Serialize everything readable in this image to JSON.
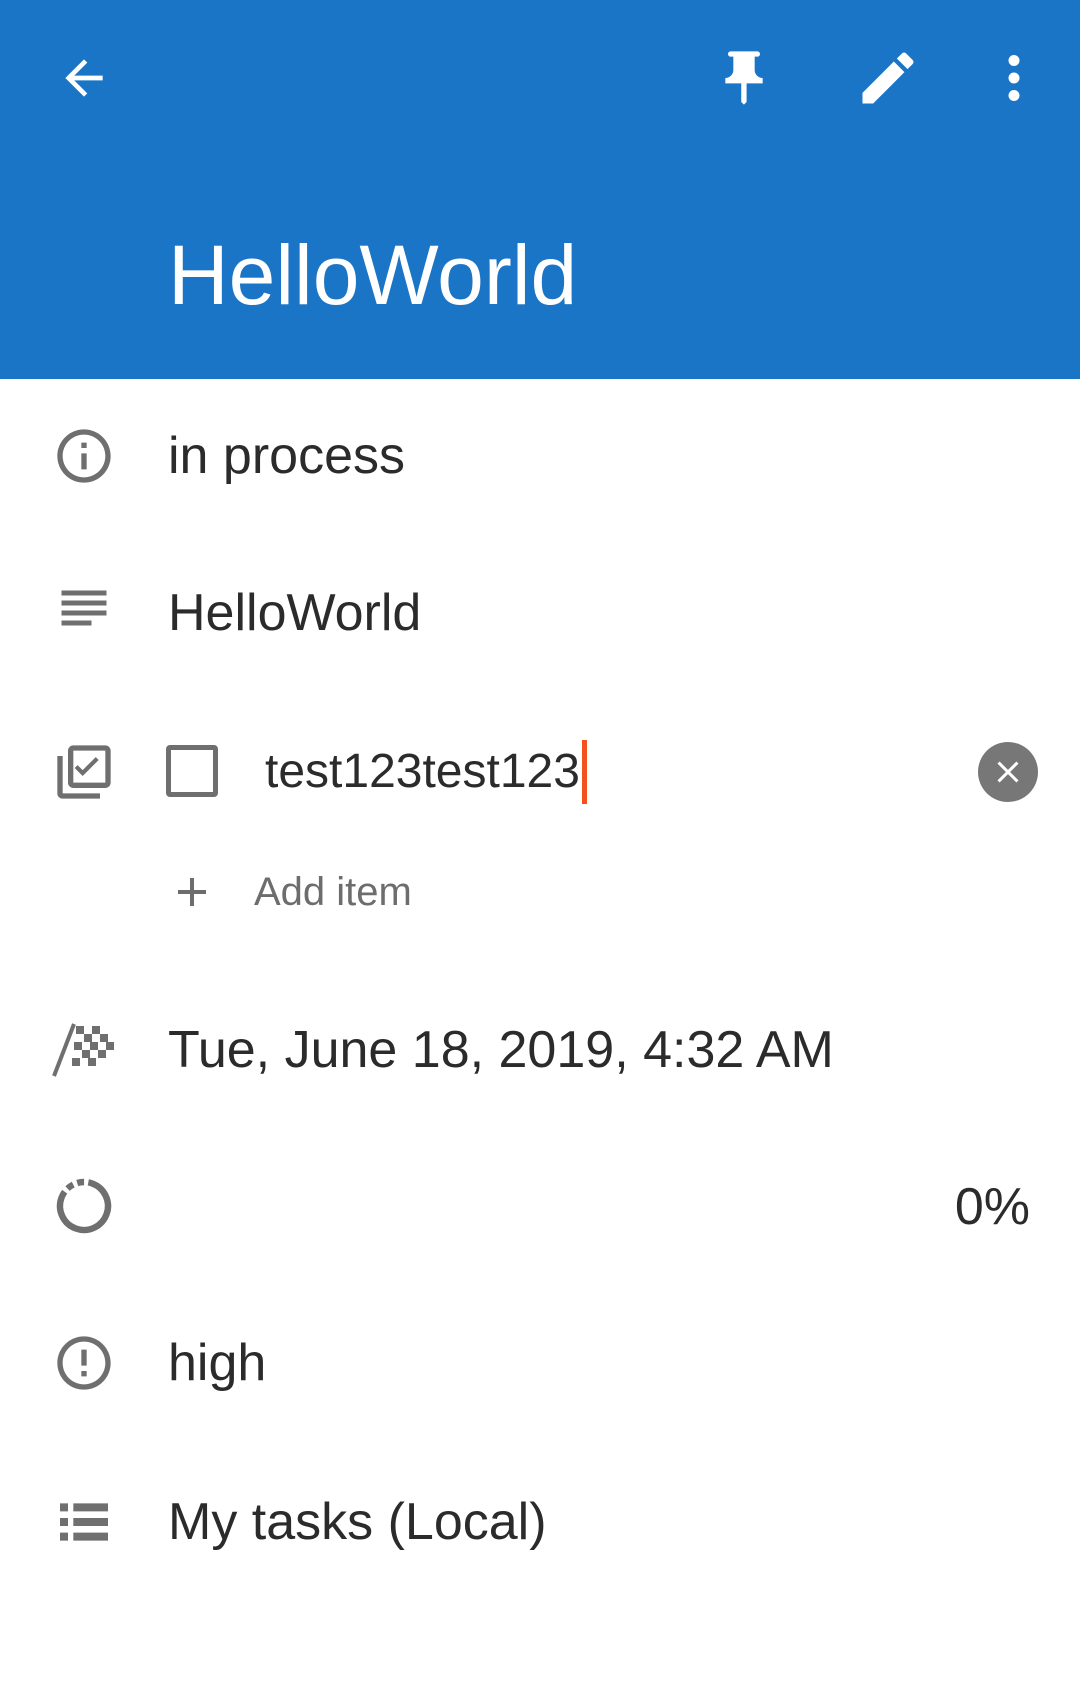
{
  "app_bar": {
    "back_icon": "arrow-back-icon",
    "pin_icon": "pin-icon",
    "edit_icon": "pencil-icon",
    "more_icon": "more-vert-icon",
    "title": "HelloWorld",
    "color": "#1B75C6"
  },
  "task": {
    "status": {
      "icon": "info-icon",
      "text": "in process"
    },
    "description": {
      "icon": "notes-icon",
      "text": "HelloWorld"
    },
    "checklist": {
      "icon": "checklist-icon",
      "items": [
        {
          "text": "test123test123",
          "checked": false
        }
      ],
      "add_label": "Add item"
    },
    "due": {
      "icon": "checkered-flag-icon",
      "text": "Tue, June 18, 2019, 4:32 AM"
    },
    "progress": {
      "icon": "progress-circle-icon",
      "text": "0%",
      "value": 0
    },
    "priority": {
      "icon": "priority-icon",
      "text": "high"
    },
    "list": {
      "icon": "list-icon",
      "text": "My tasks (Local)"
    }
  }
}
